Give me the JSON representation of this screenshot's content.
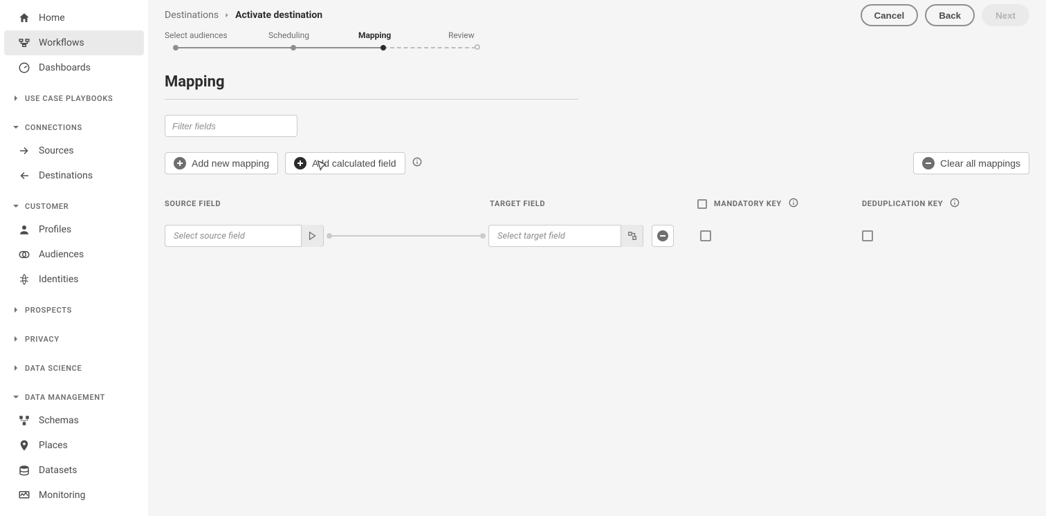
{
  "sidebar": {
    "items_top": [
      {
        "label": "Home",
        "icon": "home"
      },
      {
        "label": "Workflows",
        "icon": "workflow",
        "active": true
      },
      {
        "label": "Dashboards",
        "icon": "dashboard"
      }
    ],
    "sections": [
      {
        "label": "USE CASE PLAYBOOKS",
        "expanded": false,
        "items": []
      },
      {
        "label": "CONNECTIONS",
        "expanded": true,
        "items": [
          {
            "label": "Sources",
            "icon": "sources"
          },
          {
            "label": "Destinations",
            "icon": "destinations"
          }
        ]
      },
      {
        "label": "CUSTOMER",
        "expanded": true,
        "items": [
          {
            "label": "Profiles",
            "icon": "profile"
          },
          {
            "label": "Audiences",
            "icon": "audiences"
          },
          {
            "label": "Identities",
            "icon": "identities"
          }
        ]
      },
      {
        "label": "PROSPECTS",
        "expanded": false,
        "items": []
      },
      {
        "label": "PRIVACY",
        "expanded": false,
        "items": []
      },
      {
        "label": "DATA SCIENCE",
        "expanded": false,
        "items": []
      },
      {
        "label": "DATA MANAGEMENT",
        "expanded": true,
        "items": [
          {
            "label": "Schemas",
            "icon": "schemas"
          },
          {
            "label": "Places",
            "icon": "places"
          },
          {
            "label": "Datasets",
            "icon": "datasets"
          },
          {
            "label": "Monitoring",
            "icon": "monitoring"
          }
        ]
      }
    ]
  },
  "breadcrumb": {
    "parent": "Destinations",
    "current": "Activate destination"
  },
  "actions": {
    "cancel": "Cancel",
    "back": "Back",
    "next": "Next"
  },
  "stepper": {
    "s1": "Select audiences",
    "s2": "Scheduling",
    "s3": "Mapping",
    "s4": "Review"
  },
  "page": {
    "title": "Mapping",
    "filter_placeholder": "Filter fields",
    "add_mapping": "Add new mapping",
    "add_calc": "Add calculated field",
    "clear_all": "Clear all mappings",
    "cols": {
      "source": "SOURCE FIELD",
      "target": "TARGET FIELD",
      "mandatory": "MANDATORY KEY",
      "dedup": "DEDUPLICATION KEY"
    },
    "row": {
      "source_ph": "Select source field",
      "target_ph": "Select target field"
    }
  }
}
